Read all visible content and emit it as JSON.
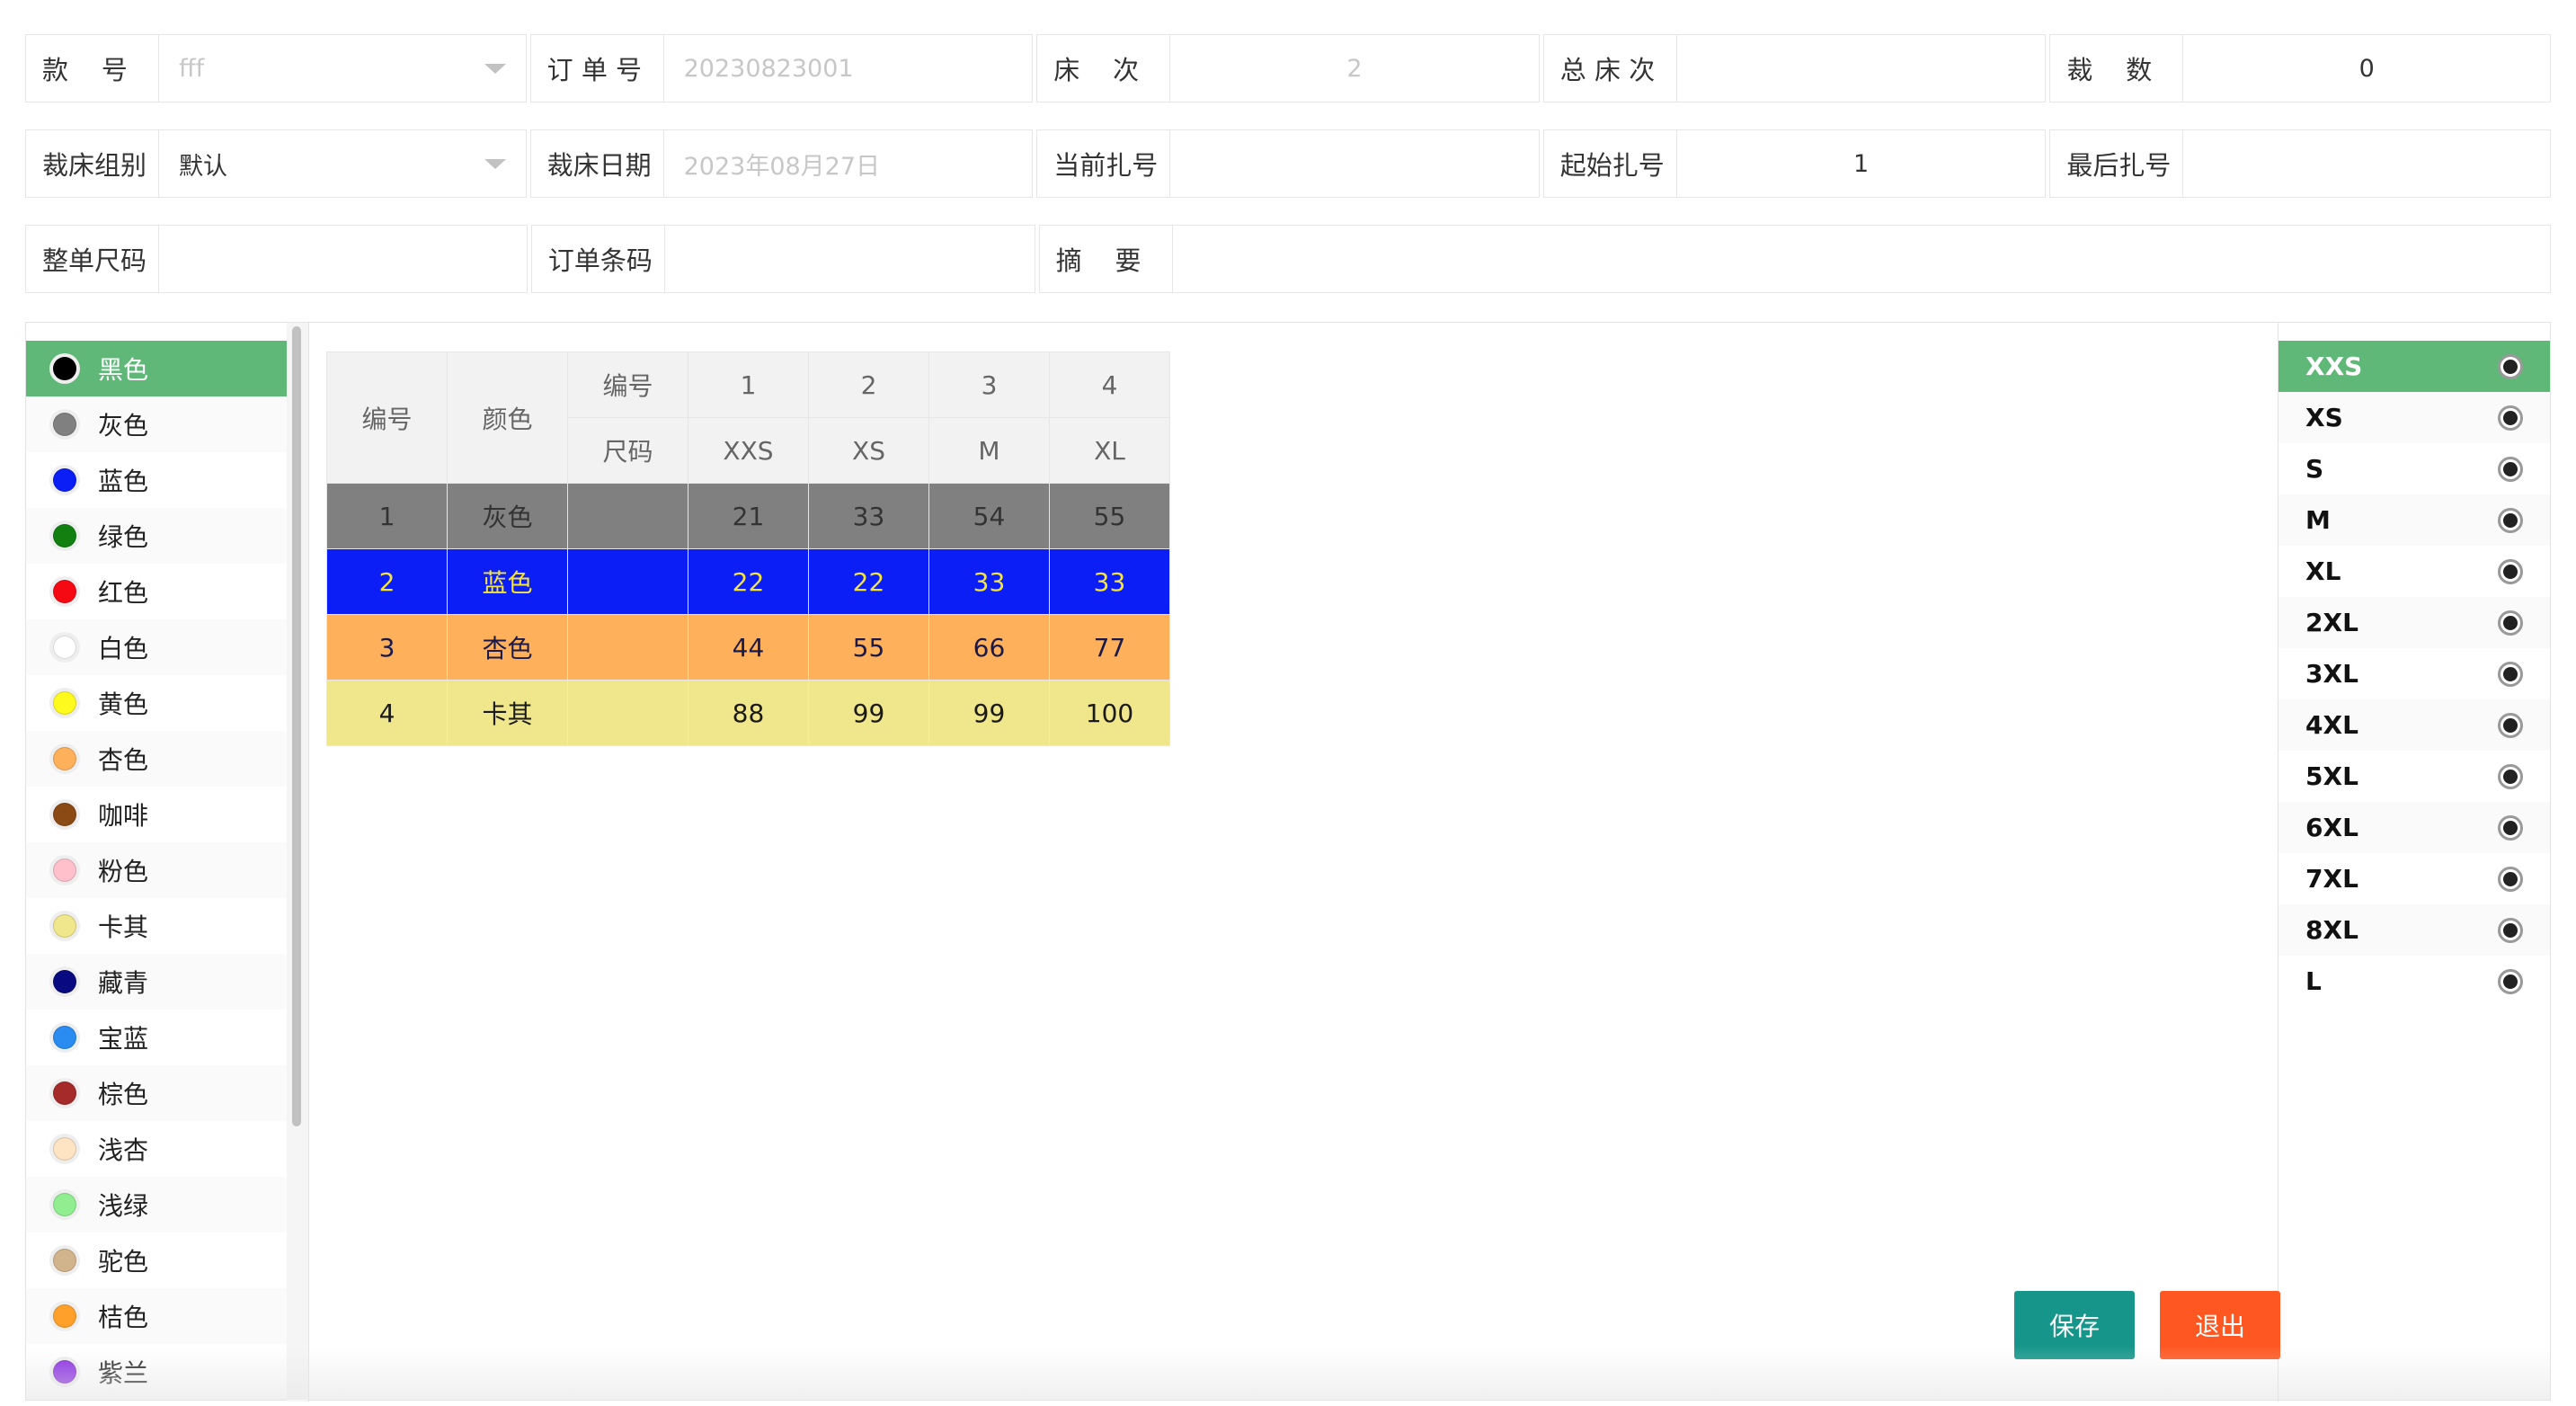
{
  "form": {
    "row1": [
      {
        "label": "款    号",
        "value": "fff",
        "muted": true,
        "dropdown": true
      },
      {
        "label": "订 单 号",
        "value": "20230823001",
        "muted": true
      },
      {
        "label": "床    次",
        "value": "2",
        "muted": true,
        "center": true
      },
      {
        "label": "总 床 次",
        "value": ""
      },
      {
        "label": "裁    数",
        "value": "0",
        "center": true
      }
    ],
    "row2": [
      {
        "label": "裁床组别",
        "value": "默认",
        "dropdown": true
      },
      {
        "label": "裁床日期",
        "value": "2023年08月27日",
        "muted": true
      },
      {
        "label": "当前扎号",
        "value": ""
      },
      {
        "label": "起始扎号",
        "value": "1",
        "center": true
      },
      {
        "label": "最后扎号",
        "value": ""
      }
    ],
    "row3": [
      {
        "label": "整单尺码",
        "value": ""
      },
      {
        "label": "订单条码",
        "value": ""
      },
      {
        "label": "摘    要",
        "value": ""
      }
    ]
  },
  "colors": [
    {
      "name": "黑色",
      "hex": "#000000",
      "active": true
    },
    {
      "name": "灰色",
      "hex": "#808080"
    },
    {
      "name": "蓝色",
      "hex": "#0a1ef5"
    },
    {
      "name": "绿色",
      "hex": "#118011"
    },
    {
      "name": "红色",
      "hex": "#f50a14"
    },
    {
      "name": "白色",
      "hex": "#ffffff"
    },
    {
      "name": "黄色",
      "hex": "#fffa1e"
    },
    {
      "name": "杏色",
      "hex": "#ffb05a"
    },
    {
      "name": "咖啡",
      "hex": "#8b4a14"
    },
    {
      "name": "粉色",
      "hex": "#ffc0cb"
    },
    {
      "name": "卡其",
      "hex": "#f0e68c"
    },
    {
      "name": "藏青",
      "hex": "#0a0a80"
    },
    {
      "name": "宝蓝",
      "hex": "#2a8cf0"
    },
    {
      "name": "棕色",
      "hex": "#a52a2a"
    },
    {
      "name": "浅杏",
      "hex": "#ffe4c4"
    },
    {
      "name": "浅绿",
      "hex": "#90ee90"
    },
    {
      "name": "驼色",
      "hex": "#d2b48c"
    },
    {
      "name": "桔色",
      "hex": "#ffa02a"
    },
    {
      "name": "紫兰",
      "hex": "#8a2be2"
    }
  ],
  "grid": {
    "h_no": "编号",
    "h_color": "颜色",
    "h_sub_no": "编号",
    "h_sub_size": "尺码",
    "col_numbers": [
      "1",
      "2",
      "3",
      "4"
    ],
    "col_sizes": [
      "XXS",
      "XS",
      "M",
      "XL"
    ],
    "rows": [
      {
        "no": "1",
        "color": "灰色",
        "values": [
          "21",
          "33",
          "54",
          "55"
        ],
        "bg": "#808080",
        "fg": "#333333"
      },
      {
        "no": "2",
        "color": "蓝色",
        "values": [
          "22",
          "22",
          "33",
          "33"
        ],
        "bg": "#0a1ef5",
        "fg": "#f5e33a"
      },
      {
        "no": "3",
        "color": "杏色",
        "values": [
          "44",
          "55",
          "66",
          "77"
        ],
        "bg": "#ffb05a",
        "fg": "#1a1a4a"
      },
      {
        "no": "4",
        "color": "卡其",
        "values": [
          "88",
          "99",
          "99",
          "100"
        ],
        "bg": "#f0e68c",
        "fg": "#1a1a1a"
      }
    ]
  },
  "sizes": [
    {
      "name": "XXS",
      "active": true
    },
    {
      "name": "XS"
    },
    {
      "name": "S"
    },
    {
      "name": "M"
    },
    {
      "name": "XL"
    },
    {
      "name": "2XL"
    },
    {
      "name": "3XL"
    },
    {
      "name": "4XL"
    },
    {
      "name": "5XL"
    },
    {
      "name": "6XL"
    },
    {
      "name": "7XL"
    },
    {
      "name": "8XL"
    },
    {
      "name": "L"
    }
  ],
  "buttons": {
    "save": "保存",
    "exit": "退出"
  },
  "theme": {
    "accent": "#5fb878",
    "save": "#16968a",
    "exit": "#ff5722"
  }
}
